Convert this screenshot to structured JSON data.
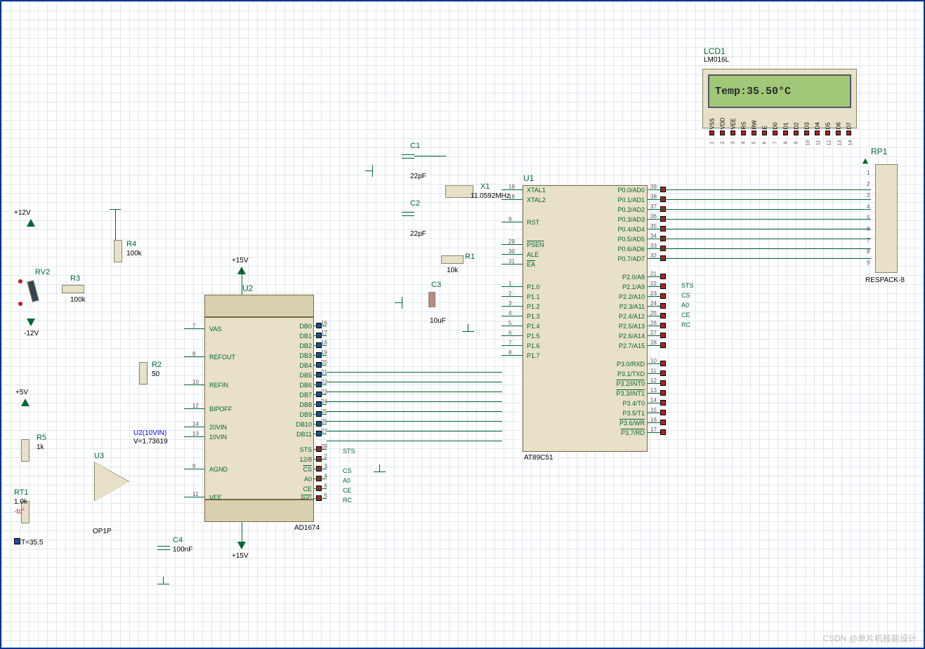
{
  "lcd": {
    "ref": "LCD1",
    "part": "LM016L",
    "text": "Temp:35.50°C",
    "pins": [
      "VSS",
      "VDD",
      "VEE",
      "RS",
      "RW",
      "E",
      "D0",
      "D1",
      "D2",
      "D3",
      "D4",
      "D5",
      "D6",
      "D7"
    ],
    "nums": [
      "1",
      "2",
      "3",
      "4",
      "5",
      "6",
      "7",
      "8",
      "9",
      "10",
      "11",
      "12",
      "13",
      "14"
    ]
  },
  "u1": {
    "ref": "U1",
    "part": "AT89C51",
    "left": [
      {
        "n": "19",
        "l": "XTAL1"
      },
      {
        "n": "18",
        "l": "XTAL2"
      },
      {
        "n": "9",
        "l": "RST"
      },
      {
        "n": "29",
        "l": "PSEN",
        "ov": true
      },
      {
        "n": "30",
        "l": "ALE"
      },
      {
        "n": "31",
        "l": "EA",
        "ov": true
      },
      {
        "n": "1",
        "l": "P1.0"
      },
      {
        "n": "2",
        "l": "P1.1"
      },
      {
        "n": "3",
        "l": "P1.2"
      },
      {
        "n": "4",
        "l": "P1.3"
      },
      {
        "n": "5",
        "l": "P1.4"
      },
      {
        "n": "6",
        "l": "P1.5"
      },
      {
        "n": "7",
        "l": "P1.6"
      },
      {
        "n": "8",
        "l": "P1.7"
      }
    ],
    "right": [
      {
        "n": "39",
        "l": "P0.0/AD0"
      },
      {
        "n": "38",
        "l": "P0.1/AD1"
      },
      {
        "n": "37",
        "l": "P0.2/AD2"
      },
      {
        "n": "36",
        "l": "P0.3/AD3"
      },
      {
        "n": "35",
        "l": "P0.4/AD4"
      },
      {
        "n": "34",
        "l": "P0.5/AD5"
      },
      {
        "n": "33",
        "l": "P0.6/AD6"
      },
      {
        "n": "32",
        "l": "P0.7/AD7"
      },
      {
        "n": "21",
        "l": "P2.0/A8"
      },
      {
        "n": "22",
        "l": "P2.1/A9"
      },
      {
        "n": "23",
        "l": "P2.2/A10"
      },
      {
        "n": "24",
        "l": "P2.3/A11"
      },
      {
        "n": "25",
        "l": "P2.4/A12"
      },
      {
        "n": "26",
        "l": "P2.5/A13"
      },
      {
        "n": "27",
        "l": "P2.6/A14"
      },
      {
        "n": "28",
        "l": "P2.7/A15"
      },
      {
        "n": "10",
        "l": "P3.0/RXD"
      },
      {
        "n": "11",
        "l": "P3.1/TXD"
      },
      {
        "n": "12",
        "l": "P3.2/INT0",
        "ov": true
      },
      {
        "n": "13",
        "l": "P3.3/INT1",
        "ov": true
      },
      {
        "n": "14",
        "l": "P3.4/T0"
      },
      {
        "n": "15",
        "l": "P3.5/T1"
      },
      {
        "n": "16",
        "l": "P3.6/WR",
        "ov": true
      },
      {
        "n": "17",
        "l": "P3.7/RD",
        "ov": true
      }
    ],
    "nets": [
      "STS",
      "CS",
      "A0",
      "CE",
      "RC"
    ]
  },
  "u2": {
    "ref": "U2",
    "part": "AD1674",
    "left": [
      {
        "n": "7",
        "l": "VAS"
      },
      {
        "n": "8",
        "l": "REFOUT"
      },
      {
        "n": "10",
        "l": "REFIN"
      },
      {
        "n": "12",
        "l": "BIPOFF"
      },
      {
        "n": "14",
        "l": "20VIN"
      },
      {
        "n": "13",
        "l": "10VIN"
      },
      {
        "n": "9",
        "l": "AGND"
      },
      {
        "n": "11",
        "l": "VEE"
      }
    ],
    "right": [
      {
        "n": "16",
        "l": "DB0"
      },
      {
        "n": "17",
        "l": "DB1"
      },
      {
        "n": "18",
        "l": "DB2"
      },
      {
        "n": "19",
        "l": "DB3"
      },
      {
        "n": "20",
        "l": "DB4"
      },
      {
        "n": "21",
        "l": "DB5"
      },
      {
        "n": "22",
        "l": "DB6"
      },
      {
        "n": "23",
        "l": "DB7"
      },
      {
        "n": "24",
        "l": "DB8"
      },
      {
        "n": "25",
        "l": "DB9"
      },
      {
        "n": "26",
        "l": "DB10"
      },
      {
        "n": "27",
        "l": "DB11"
      },
      {
        "n": "28",
        "l": "STS"
      },
      {
        "n": "2",
        "l": "12/8"
      },
      {
        "n": "3",
        "l": "CS",
        "ov": true
      },
      {
        "n": "4",
        "l": "A0"
      },
      {
        "n": "6",
        "l": "CE"
      },
      {
        "n": "5",
        "l": "R/C",
        "ov": true
      }
    ],
    "nets": [
      "STS",
      "CS",
      "A0",
      "CE",
      "RC"
    ]
  },
  "u3": {
    "ref": "U3",
    "part": "OP1P"
  },
  "c1": {
    "ref": "C1",
    "val": "22pF"
  },
  "c2": {
    "ref": "C2",
    "val": "22pF"
  },
  "c3": {
    "ref": "C3",
    "val": "10uF"
  },
  "c4": {
    "ref": "C4",
    "val": "100nF"
  },
  "r1": {
    "ref": "R1",
    "val": "10k"
  },
  "r2": {
    "ref": "R2",
    "val": "50"
  },
  "r3": {
    "ref": "R3",
    "val": "100k"
  },
  "r4": {
    "ref": "R4",
    "val": "100k"
  },
  "r5": {
    "ref": "R5",
    "val": "1k"
  },
  "rt1": {
    "ref": "RT1",
    "val": "1.0k",
    "tc": "-tc°",
    "meas": "T=35.5"
  },
  "rv2": {
    "ref": "RV2"
  },
  "rp1": {
    "ref": "RP1",
    "part": "RESPACK-8",
    "pins": [
      "1",
      "2",
      "3",
      "4",
      "5",
      "6",
      "7",
      "8",
      "9"
    ]
  },
  "x1": {
    "ref": "X1",
    "val": "11.0592MHz"
  },
  "pwr": {
    "p12": "+12V",
    "m12": "-12V",
    "p5": "+5V",
    "p15a": "+15V",
    "p15b": "+15V"
  },
  "probe": {
    "name": "U2(10VIN)",
    "val": "V=1.73619"
  },
  "watermark": "CSDN @单片机技能设计"
}
